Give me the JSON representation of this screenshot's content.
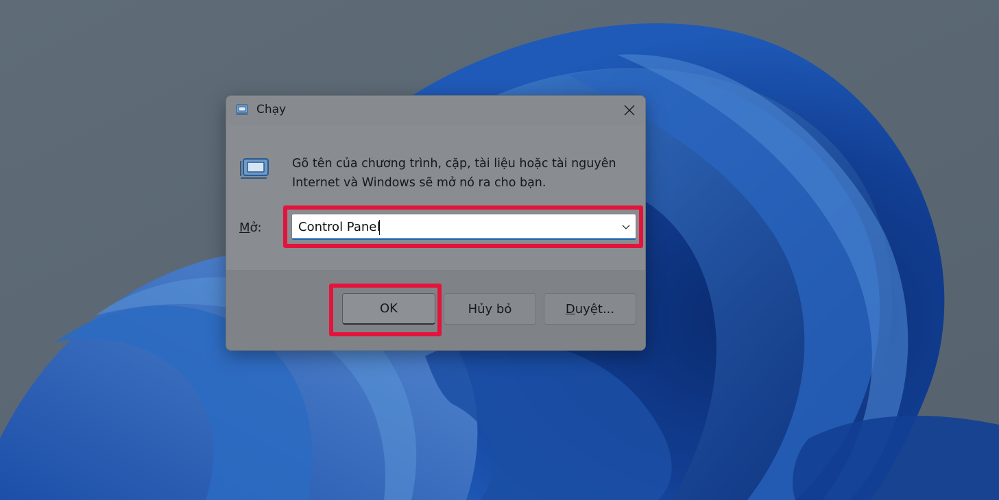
{
  "dialog": {
    "title": "Chạy",
    "description": "Gõ tên của chương trình, cặp, tài liệu hoặc tài nguyên Internet và Windows sẽ mở nó ra cho bạn.",
    "open_label_mnemonic": "M",
    "open_label_rest": "ở:",
    "open_value": "Control Panel",
    "buttons": {
      "ok": "OK",
      "cancel": "Hủy bỏ",
      "browse_mnemonic": "D",
      "browse_rest": "uyệt..."
    }
  },
  "icons": {
    "title": "run-app-icon",
    "content": "run-app-icon",
    "close": "close-icon",
    "dropdown": "chevron-down-icon"
  },
  "colors": {
    "highlight": "#e3143c",
    "accent": "#1a5fb4"
  }
}
